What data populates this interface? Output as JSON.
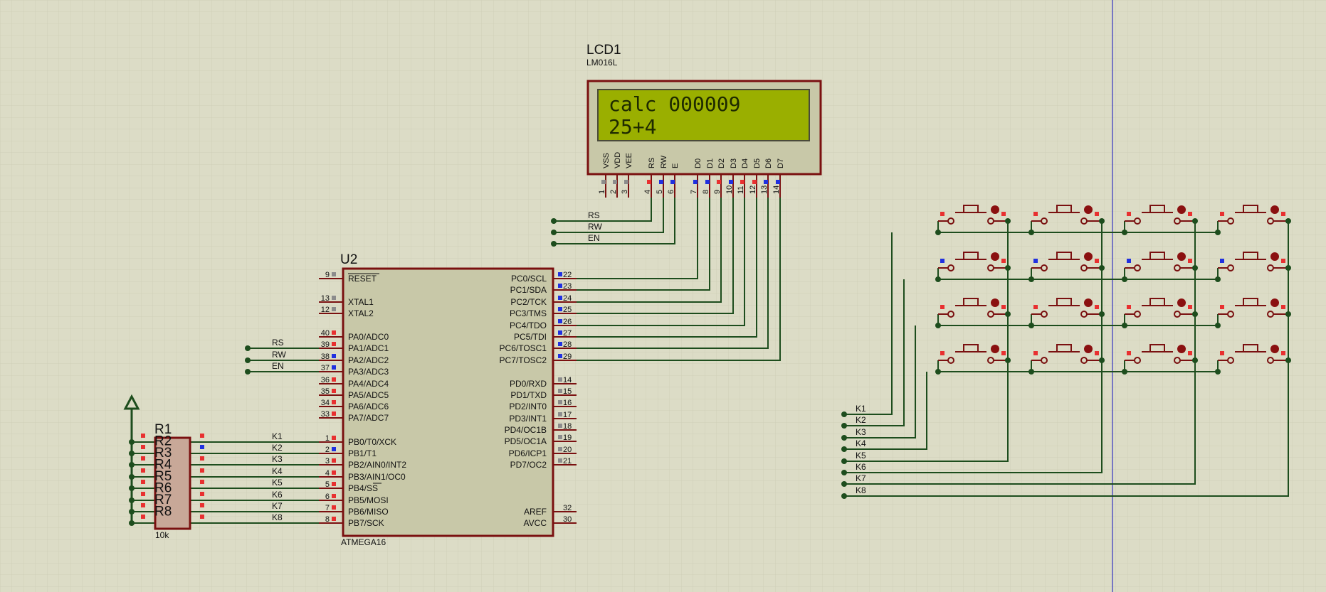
{
  "colors": {
    "background": "#dcdcc6",
    "grid": "#cfcfb8",
    "wire": "#1d4d1d",
    "part_border": "#7a1010",
    "part_fill": "#c8c8a8",
    "lcd_screen": "#9aaf00",
    "lcd_text": "#1e2a00",
    "cursor_line": "#1010c0",
    "pin_red": "#e83030",
    "pin_blue": "#2030e0",
    "pin_gray": "#8c8c8c"
  },
  "lcd": {
    "ref": "LCD1",
    "model": "LM016L",
    "line1": "calc 000009",
    "line2": "25+4",
    "pins": [
      {
        "label": "VSS",
        "num": "1"
      },
      {
        "label": "VDD",
        "num": "2"
      },
      {
        "label": "VEE",
        "num": "3"
      },
      {
        "label": "RS",
        "num": "4"
      },
      {
        "label": "RW",
        "num": "5"
      },
      {
        "label": "E",
        "num": "6"
      },
      {
        "label": "D0",
        "num": "7"
      },
      {
        "label": "D1",
        "num": "8"
      },
      {
        "label": "D2",
        "num": "9"
      },
      {
        "label": "D3",
        "num": "10"
      },
      {
        "label": "D4",
        "num": "11"
      },
      {
        "label": "D5",
        "num": "12"
      },
      {
        "label": "D6",
        "num": "13"
      },
      {
        "label": "D7",
        "num": "14"
      }
    ],
    "net_labels": [
      "RS",
      "RW",
      "EN"
    ]
  },
  "mcu": {
    "ref": "U2",
    "model": "ATMEGA16",
    "left_pins": [
      {
        "label": "RESET",
        "num": "9"
      },
      {
        "label": "XTAL1",
        "num": "13"
      },
      {
        "label": "XTAL2",
        "num": "12"
      },
      {
        "label": "PA0/ADC0",
        "num": "40"
      },
      {
        "label": "PA1/ADC1",
        "num": "39"
      },
      {
        "label": "PA2/ADC2",
        "num": "38"
      },
      {
        "label": "PA3/ADC3",
        "num": "37"
      },
      {
        "label": "PA4/ADC4",
        "num": "36"
      },
      {
        "label": "PA5/ADC5",
        "num": "35"
      },
      {
        "label": "PA6/ADC6",
        "num": "34"
      },
      {
        "label": "PA7/ADC7",
        "num": "33"
      },
      {
        "label": "PB0/T0/XCK",
        "num": "1"
      },
      {
        "label": "PB1/T1",
        "num": "2"
      },
      {
        "label": "PB2/AIN0/INT2",
        "num": "3"
      },
      {
        "label": "PB3/AIN1/OC0",
        "num": "4"
      },
      {
        "label": "PB4/SS",
        "num": "5"
      },
      {
        "label": "PB5/MOSI",
        "num": "6"
      },
      {
        "label": "PB6/MISO",
        "num": "7"
      },
      {
        "label": "PB7/SCK",
        "num": "8"
      }
    ],
    "right_pins": [
      {
        "label": "PC0/SCL",
        "num": "22"
      },
      {
        "label": "PC1/SDA",
        "num": "23"
      },
      {
        "label": "PC2/TCK",
        "num": "24"
      },
      {
        "label": "PC3/TMS",
        "num": "25"
      },
      {
        "label": "PC4/TDO",
        "num": "26"
      },
      {
        "label": "PC5/TDI",
        "num": "27"
      },
      {
        "label": "PC6/TOSC1",
        "num": "28"
      },
      {
        "label": "PC7/TOSC2",
        "num": "29"
      },
      {
        "label": "PD0/RXD",
        "num": "14"
      },
      {
        "label": "PD1/TXD",
        "num": "15"
      },
      {
        "label": "PD2/INT0",
        "num": "16"
      },
      {
        "label": "PD3/INT1",
        "num": "17"
      },
      {
        "label": "PD4/OC1B",
        "num": "18"
      },
      {
        "label": "PD5/OC1A",
        "num": "19"
      },
      {
        "label": "PD6/ICP1",
        "num": "20"
      },
      {
        "label": "PD7/OC2",
        "num": "21"
      },
      {
        "label": "AREF",
        "num": "32"
      },
      {
        "label": "AVCC",
        "num": "30"
      }
    ],
    "porta_nets": [
      "RS",
      "RW",
      "EN"
    ],
    "portb_nets": [
      "K1",
      "K2",
      "K3",
      "K4",
      "K5",
      "K6",
      "K7",
      "K8"
    ]
  },
  "resistor_pack": {
    "refs": [
      "R1",
      "R2",
      "R3",
      "R4",
      "R5",
      "R6",
      "R7",
      "R8"
    ],
    "value": "10k"
  },
  "keypad": {
    "rows": 4,
    "cols": 4,
    "net_labels": [
      "K1",
      "K2",
      "K3",
      "K4",
      "K5",
      "K6",
      "K7",
      "K8"
    ]
  }
}
